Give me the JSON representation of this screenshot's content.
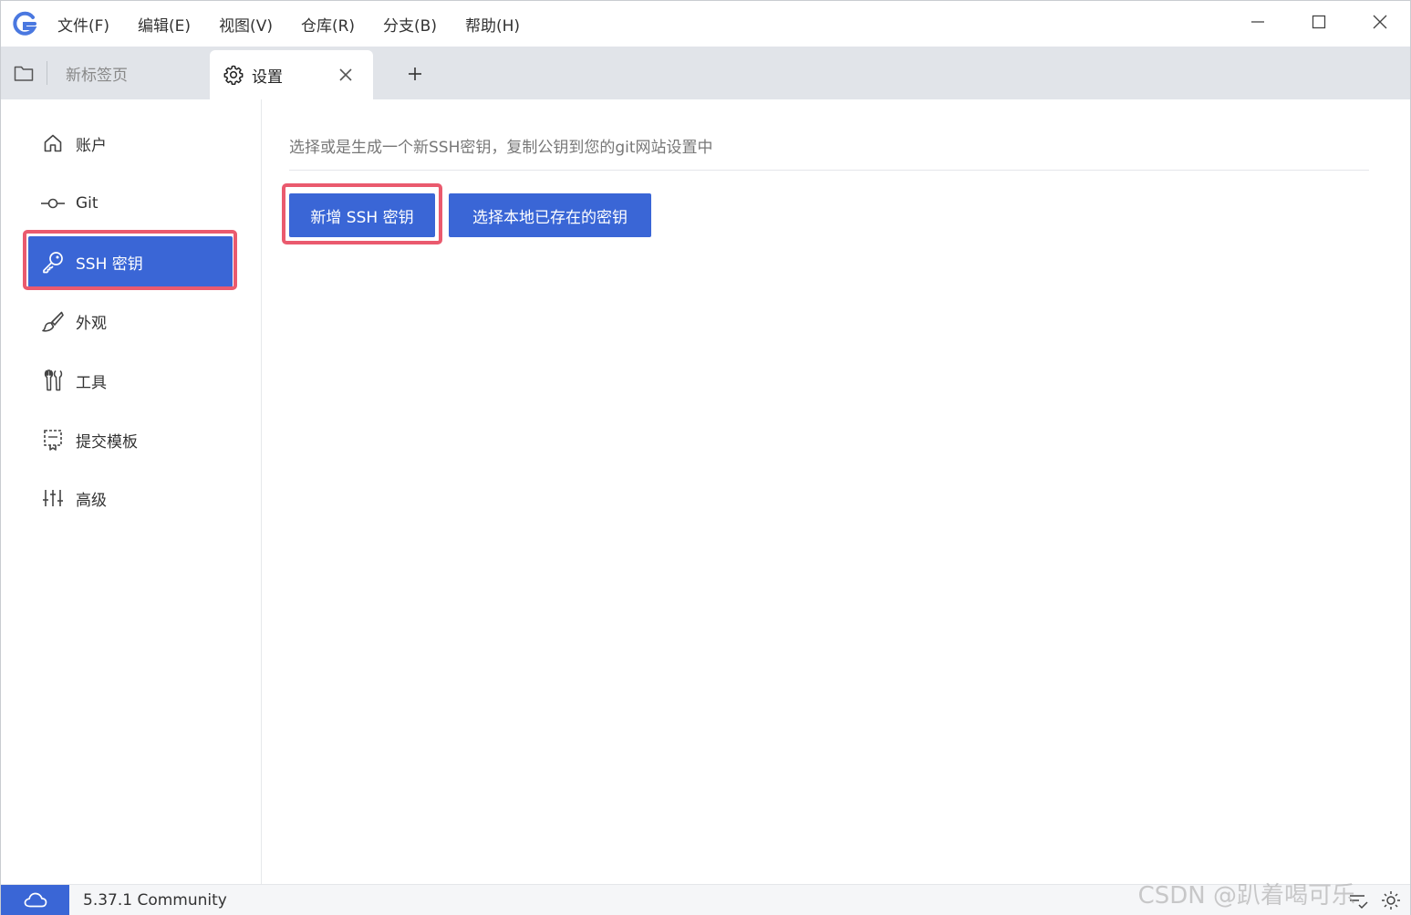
{
  "menu": [
    "文件(F)",
    "编辑(E)",
    "视图(V)",
    "仓库(R)",
    "分支(B)",
    "帮助(H)"
  ],
  "tabs": {
    "inactive_label": "新标签页",
    "active_label": "设置",
    "add_symbol": "+"
  },
  "sidebar": {
    "items": [
      {
        "label": "账户",
        "icon": "home-icon"
      },
      {
        "label": "Git",
        "icon": "git-commit-icon"
      },
      {
        "label": "SSH 密钥",
        "icon": "key-icon"
      },
      {
        "label": "外观",
        "icon": "brush-icon"
      },
      {
        "label": "工具",
        "icon": "tools-icon"
      },
      {
        "label": "提交模板",
        "icon": "template-icon"
      },
      {
        "label": "高级",
        "icon": "sliders-icon"
      }
    ],
    "active_index": 2
  },
  "main": {
    "description": "选择或是生成一个新SSH密钥，复制公钥到您的git网站设置中",
    "new_key_button": "新增 SSH 密钥",
    "select_key_button": "选择本地已存在的密钥"
  },
  "status": {
    "version": "5.37.1 Community"
  },
  "watermark": "CSDN @趴着喝可乐",
  "colors": {
    "accent": "#3a66d6",
    "highlight": "#ea5a6e",
    "tabbar": "#e1e4e9"
  }
}
